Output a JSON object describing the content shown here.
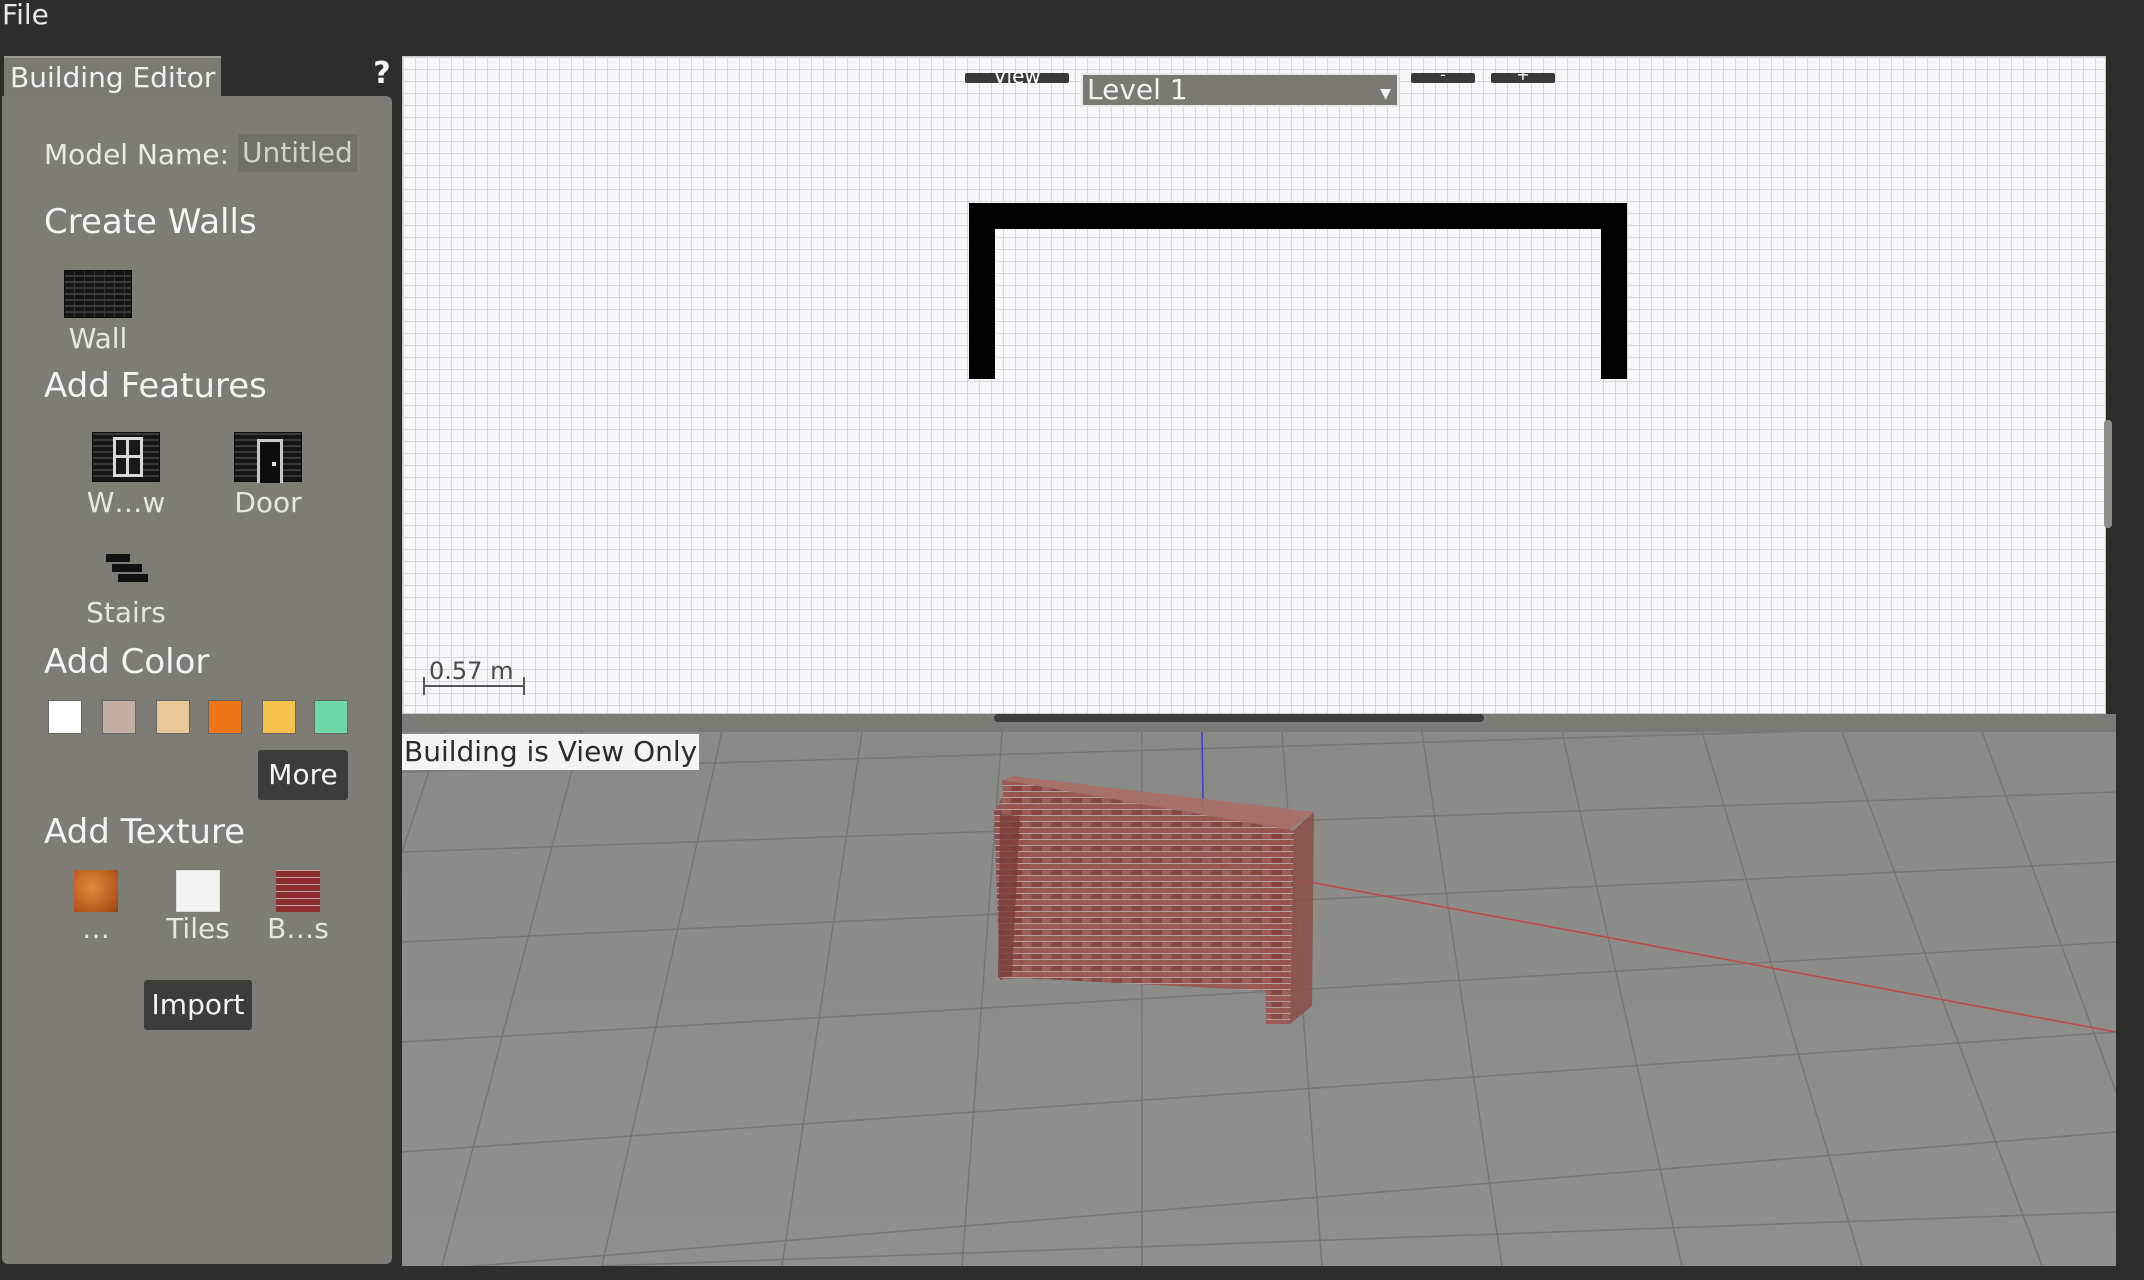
{
  "menu": {
    "file_label": "File"
  },
  "panel": {
    "tab_title": "Building Editor",
    "help_glyph": "?",
    "model_name_label": "Model Name:",
    "model_name_value": "Untitled",
    "sections": {
      "create_walls": "Create Walls",
      "add_features": "Add Features",
      "add_color": "Add Color",
      "add_texture": "Add Texture"
    },
    "tools": {
      "wall": "Wall",
      "window": "W…w",
      "door": "Door",
      "stairs": "Stairs"
    },
    "colors": [
      "#ffffff",
      "#c4aea4",
      "#e8c896",
      "#ee7418",
      "#f5c04c",
      "#6ed8a8"
    ],
    "more_label": "More",
    "textures": {
      "wood": "…",
      "tiles": "Tiles",
      "bricks": "B…s"
    },
    "import_label": "Import"
  },
  "editor2d": {
    "view_label": "View",
    "level_value": "Level 1",
    "zoom_out_label": "-",
    "zoom_in_label": "+",
    "scale_label": "0.57 m"
  },
  "view3d": {
    "status_label": "Building is View Only"
  },
  "icons": {
    "help": "question-mark-icon",
    "wall": "brick-wall-icon",
    "window": "window-icon",
    "door": "door-icon",
    "stairs": "stairs-icon",
    "dropdown": "chevron-down-icon"
  }
}
